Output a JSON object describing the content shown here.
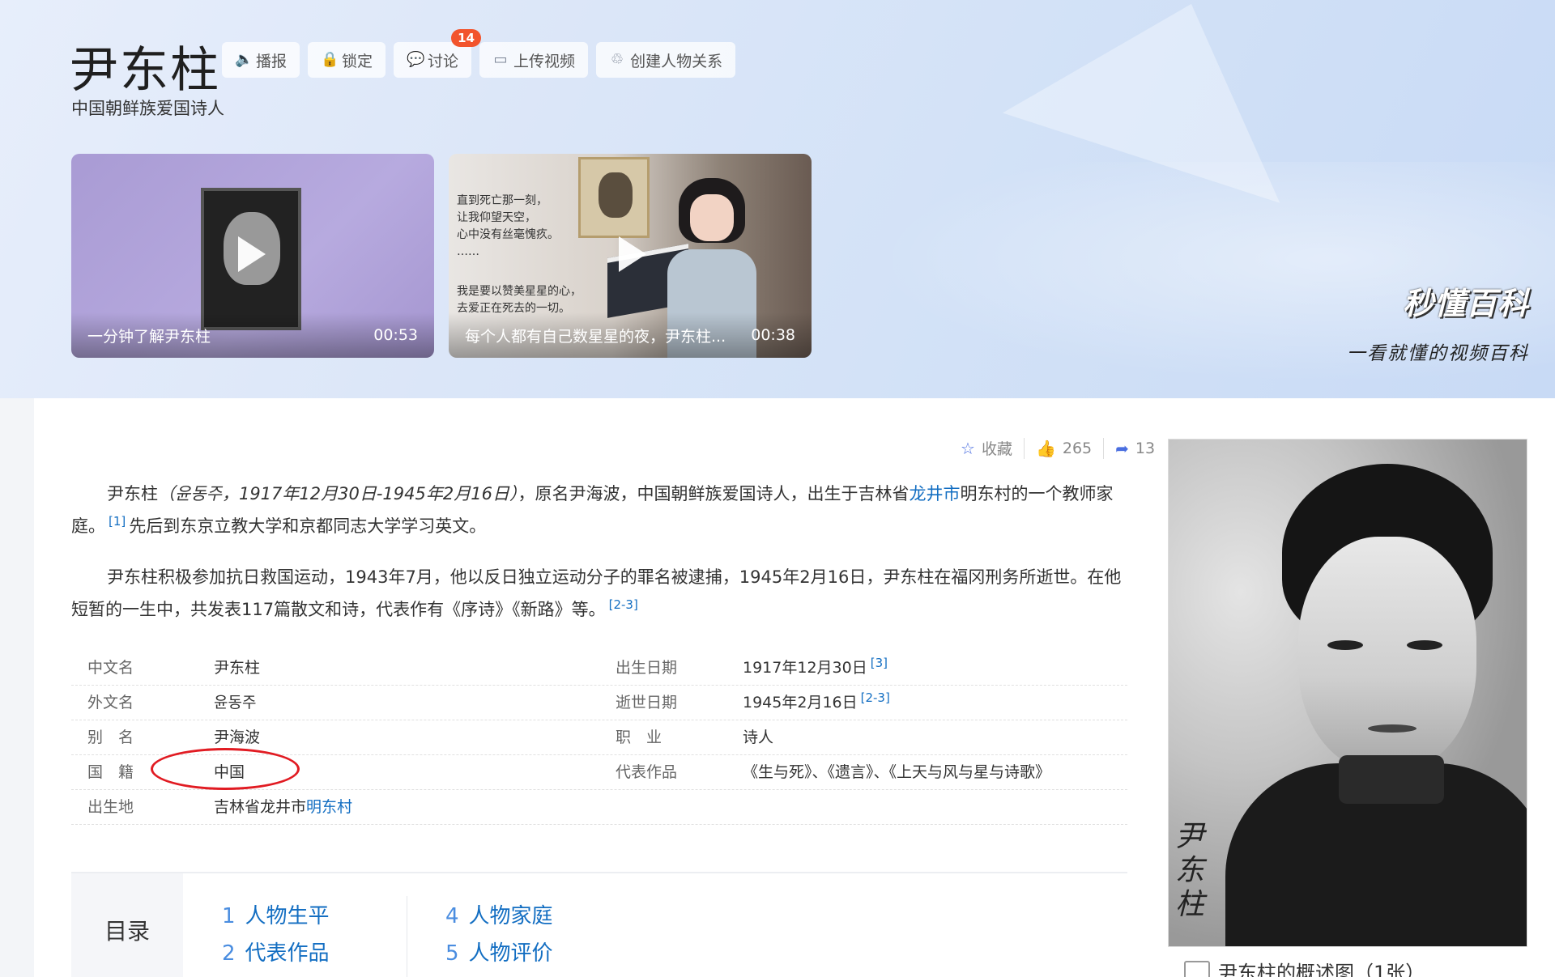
{
  "header": {
    "title": "尹东柱",
    "subtitle": "中国朝鲜族爱国诗人",
    "actions": [
      {
        "label": "播报",
        "icon": "speaker-icon"
      },
      {
        "label": "锁定",
        "icon": "lock-icon"
      },
      {
        "label": "讨论",
        "icon": "chat-icon",
        "badge": "14"
      },
      {
        "label": "上传视频",
        "icon": "video-icon"
      },
      {
        "label": "创建人物关系",
        "icon": "relation-icon"
      }
    ]
  },
  "videos": [
    {
      "title": "一分钟了解尹东柱",
      "duration": "00:53"
    },
    {
      "title": "每个人都有自己数星星的夜，尹东柱...",
      "duration": "00:38",
      "overlay_text_1": "直到死亡那一刻，\n让我仰望天空，\n心中没有丝毫愧疚。\n……",
      "overlay_text_2": "我是要以赞美星星的心，\n去爱正在死去的一切。"
    }
  ],
  "brand": {
    "logo": "秒懂百科",
    "slogan": "一看就懂的视频百科"
  },
  "stats": {
    "favorite_label": "收藏",
    "likes": "265",
    "shares": "13"
  },
  "intro": {
    "p1_name": "尹东柱",
    "p1_paren": "（윤동주，1917年12月30日-1945年2月16日）",
    "p1_text_a": "，原名尹海波，中国朝鲜族爱国诗人，出生于吉林省",
    "p1_link": "龙井市",
    "p1_text_b": "明东村的一个教师家庭。",
    "p1_ref": "[1]",
    "p1_text_c": "先后到东京立教大学和京都同志大学学习英文。",
    "p2_text": "尹东柱积极参加抗日救国运动，1943年7月，他以反日独立运动分子的罪名被逮捕，1945年2月16日，尹东柱在福冈刑务所逝世。在他短暂的一生中，共发表117篇散文和诗，代表作有《序诗》《新路》等。",
    "p2_ref": "[2-3]"
  },
  "info": {
    "rows": [
      {
        "k1": "中文名",
        "v1": "尹东柱",
        "k2": "出生日期",
        "v2": "1917年12月30日",
        "r2": "[3]"
      },
      {
        "k1": "外文名",
        "v1": "윤동주",
        "k2": "逝世日期",
        "v2": "1945年2月16日",
        "r2": "[2-3]"
      },
      {
        "k1": "别　名",
        "v1": "尹海波",
        "k2": "职　业",
        "v2": "诗人",
        "r2": ""
      },
      {
        "k1": "国　籍",
        "v1": "中国",
        "k2": "代表作品",
        "v2": "《生与死》、《遗言》、《上天与风与星与诗歌》",
        "r2": ""
      },
      {
        "k1": "出生地",
        "v1": "吉林省龙井市",
        "v1_link": "明东村",
        "k2": "",
        "v2": "",
        "r2": ""
      }
    ]
  },
  "catalog": {
    "title": "目录",
    "col1": [
      {
        "n": "1",
        "label": "人物生平"
      },
      {
        "n": "2",
        "label": "代表作品"
      }
    ],
    "col2": [
      {
        "n": "4",
        "label": "人物家庭"
      },
      {
        "n": "5",
        "label": "人物评价"
      }
    ]
  },
  "side": {
    "signature": "尹东柱",
    "caption": "尹东柱的概述图（1张）"
  },
  "colors": {
    "link": "#136ec2",
    "badge": "#f2542d",
    "annotation_ring": "#e11b22"
  }
}
